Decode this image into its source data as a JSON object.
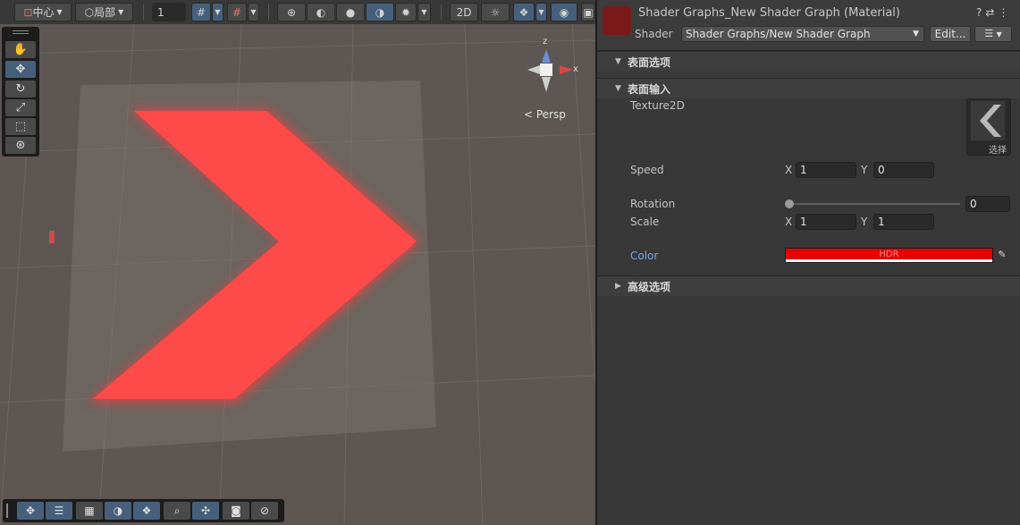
{
  "toolbar": {
    "pivot_label": "中心",
    "space_label": "局部",
    "snap_value": "1"
  },
  "scene": {
    "persp_label": "< Persp",
    "gizmo_axes": {
      "z": "z",
      "x": "x"
    }
  },
  "inspector": {
    "title": "Shader Graphs_New Shader Graph (Material)",
    "shader_label": "Shader",
    "shader_value": "Shader Graphs/New Shader Graph",
    "edit_label": "Edit...",
    "sections": {
      "surface_options": "表面选项",
      "surface_inputs": "表面输入",
      "advanced_options": "高级选项"
    },
    "texture": {
      "label": "Texture2D",
      "select_label": "选择"
    },
    "speed": {
      "label": "Speed",
      "x_axis": "X",
      "x": "1",
      "y_axis": "Y",
      "y": "0"
    },
    "rotation": {
      "label": "Rotation",
      "value": "0",
      "slider_fraction": 0
    },
    "scale": {
      "label": "Scale",
      "x_axis": "X",
      "x": "1",
      "y_axis": "Y",
      "y": "1"
    },
    "color": {
      "label": "Color",
      "hdr_label": "HDR",
      "value": "#e60000"
    }
  }
}
